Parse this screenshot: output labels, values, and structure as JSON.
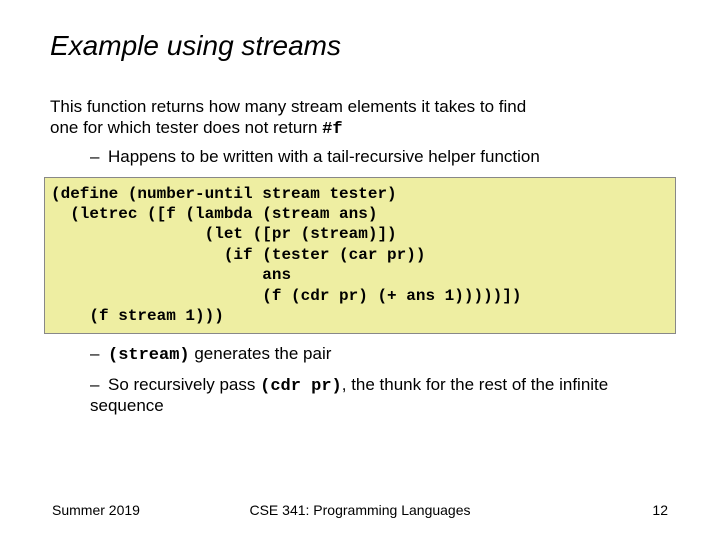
{
  "title": "Example using streams",
  "intro_line1": "This function returns how many stream elements it takes to find",
  "intro_line2_prefix": "one for which tester does not return ",
  "intro_code": "#f",
  "bullet1": "Happens to be written with a tail-recursive helper function",
  "code": "(define (number-until stream tester)\n  (letrec ([f (lambda (stream ans)\n                (let ([pr (stream)])\n                  (if (tester (car pr))\n                      ans\n                      (f (cdr pr) (+ ans 1)))))])\n    (f stream 1)))",
  "bullet2_code": "(stream)",
  "bullet2_rest": " generates the pair",
  "bullet3_prefix": "So recursively pass ",
  "bullet3_code": "(cdr pr)",
  "bullet3_rest": ", the thunk for the rest of the infinite sequence",
  "footer_left": "Summer 2019",
  "footer_center": "CSE 341: Programming Languages",
  "footer_right": "12"
}
